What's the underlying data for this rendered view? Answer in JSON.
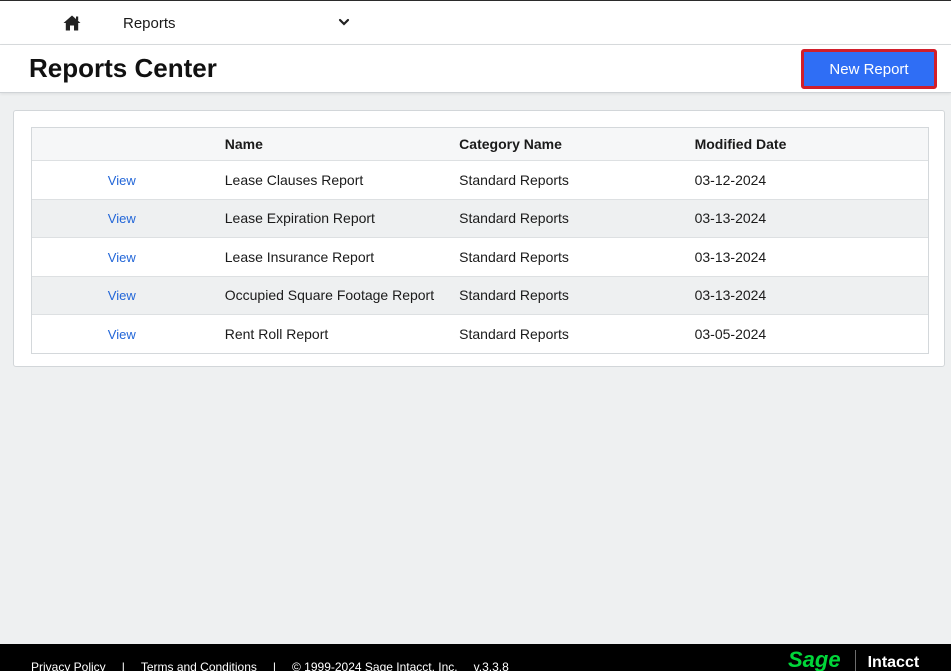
{
  "topnav": {
    "home_icon": "home-icon",
    "module_label": "Reports",
    "chevron_icon": "chevron-down-icon"
  },
  "header": {
    "title": "Reports Center",
    "new_report_label": "New Report",
    "accent": "#2f6ef5",
    "highlight": "#d11f2b"
  },
  "table": {
    "columns": [
      "",
      "Name",
      "Category Name",
      "Modified Date"
    ],
    "rows": [
      {
        "action": "View",
        "name": "Lease Clauses Report",
        "category": "Standard Reports",
        "modified": "03-12-2024"
      },
      {
        "action": "View",
        "name": "Lease Expiration Report",
        "category": "Standard Reports",
        "modified": "03-13-2024"
      },
      {
        "action": "View",
        "name": "Lease Insurance Report",
        "category": "Standard Reports",
        "modified": "03-13-2024"
      },
      {
        "action": "View",
        "name": "Occupied Square Footage Report",
        "category": "Standard Reports",
        "modified": "03-13-2024"
      },
      {
        "action": "View",
        "name": "Rent Roll Report",
        "category": "Standard Reports",
        "modified": "03-05-2024"
      }
    ]
  },
  "footer": {
    "privacy": "Privacy Policy",
    "separator": "|",
    "terms": "Terms and Conditions",
    "copyright": "© 1999-2024 Sage Intacct, Inc.",
    "version": "v.3.3.8",
    "brand_sage": "Sage",
    "brand_intacct": "Intacct"
  }
}
